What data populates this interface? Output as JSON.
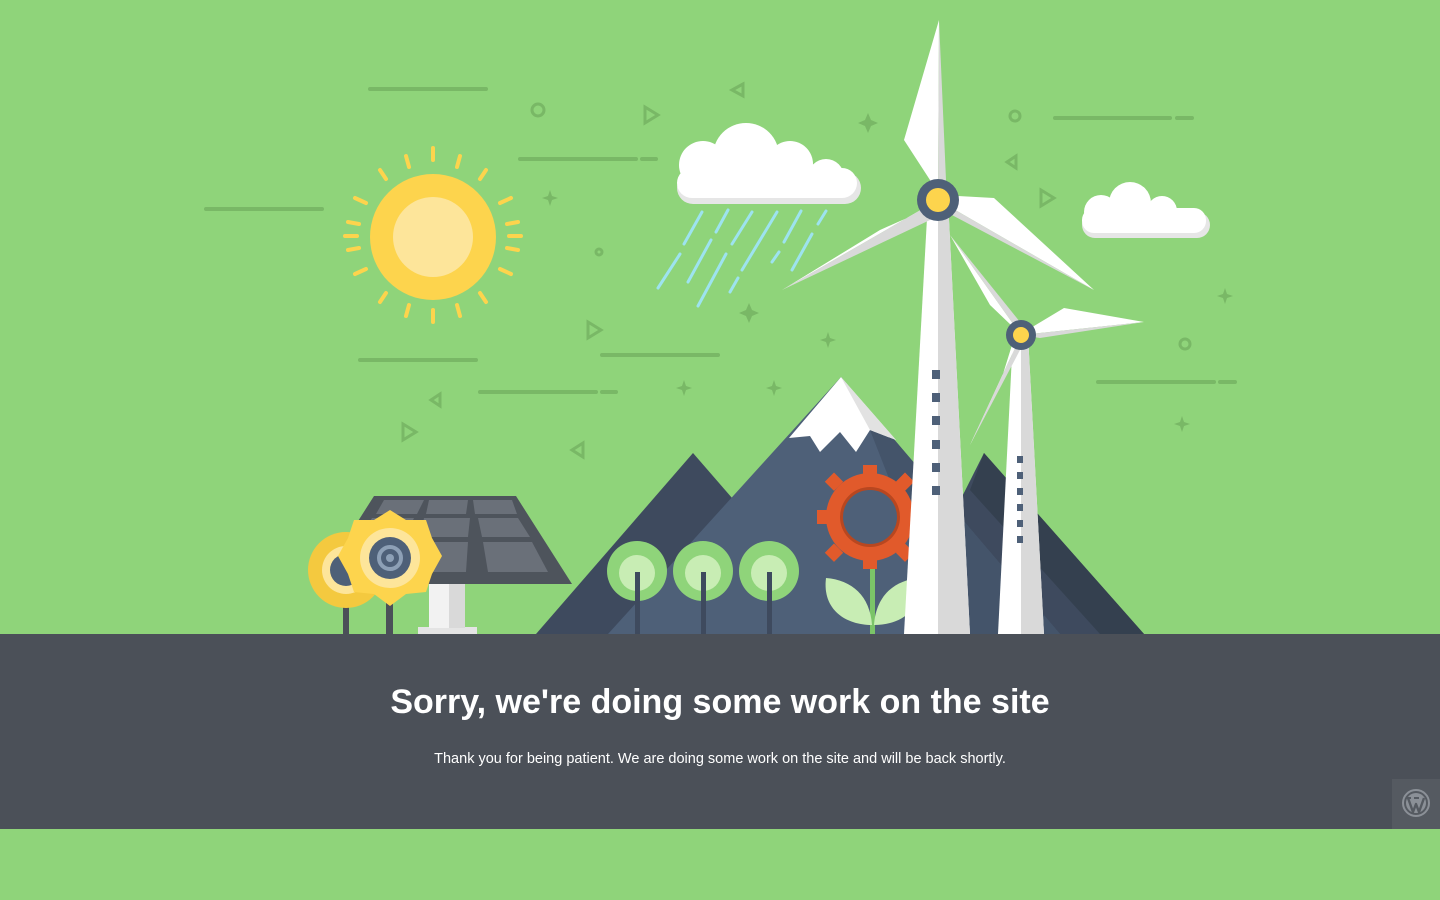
{
  "page": {
    "headline": "Sorry, we're doing some work on the site",
    "message": "Thank you for being patient. We are doing some work on the site and will be back shortly."
  },
  "colors": {
    "background": "#8fd47a",
    "panel": "#4b5058",
    "text": "#ffffff",
    "sun": "#fdd44d",
    "gear": "#e15a2b",
    "mountain": "#4e6078"
  },
  "icons": {
    "badge": "wordpress-logo-icon"
  }
}
